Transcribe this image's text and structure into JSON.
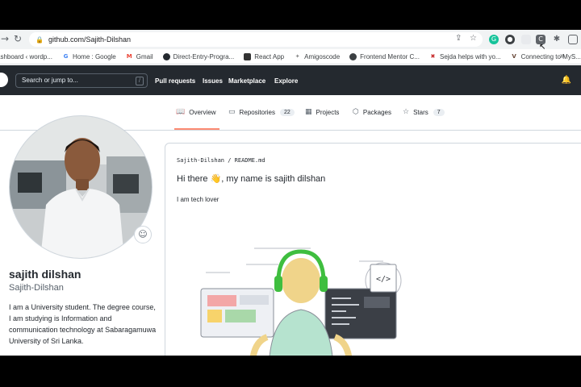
{
  "browser": {
    "url": "github.com/Sajith-Dilshan",
    "back_icon": "arrow-right-icon",
    "reload_icon": "reload-icon",
    "bookmarks": [
      {
        "label": "ashboard ‹ wordp...",
        "color": "#3c4043"
      },
      {
        "label": "Home : Google",
        "color": "#4285f4",
        "glyph": "G"
      },
      {
        "label": "Gmail",
        "color": "#ea4335",
        "glyph": "M"
      },
      {
        "label": "Direct-Entry-Progra...",
        "color": "#24292f",
        "glyph": "●"
      },
      {
        "label": "React App",
        "color": "#333333",
        "glyph": "▪"
      },
      {
        "label": "Amigoscode",
        "color": "#888888",
        "glyph": "✦"
      },
      {
        "label": "Frontend Mentor C...",
        "color": "#3c4043",
        "glyph": "●"
      },
      {
        "label": "Sejda helps with yo...",
        "color": "#c62828",
        "glyph": "✖"
      },
      {
        "label": "Connecting to MyS...",
        "color": "#6a4a3a",
        "glyph": "V"
      }
    ],
    "more_bookmarks": "»"
  },
  "header": {
    "search_placeholder": "Search or jump to...",
    "search_shortcut": "/",
    "nav": [
      "Pull requests",
      "Issues",
      "Marketplace",
      "Explore"
    ]
  },
  "tabs": [
    {
      "label": "Overview",
      "icon": "book-icon"
    },
    {
      "label": "Repositories",
      "icon": "repo-icon",
      "count": "22"
    },
    {
      "label": "Projects",
      "icon": "table-icon"
    },
    {
      "label": "Packages",
      "icon": "package-icon"
    },
    {
      "label": "Stars",
      "icon": "star-icon",
      "count": "7"
    }
  ],
  "profile": {
    "name": "sajith dilshan",
    "username": "Sajith-Dilshan",
    "bio": "I am a University student. The degree course, I am studying is Information and communication technology at Sabaragamuwa University of Sri Lanka."
  },
  "readme": {
    "path": "Sajith-Dilshan / README.md",
    "title_prefix": "Hi there",
    "title_suffix": ", my name is sajith dilshan",
    "wave_emoji": "👋",
    "text": "I am tech lover",
    "code_glyph": "</>"
  },
  "colors": {
    "gh_header": "#24292f",
    "tab_underline": "#fd8c73",
    "headphones": "#3fbe3f"
  }
}
